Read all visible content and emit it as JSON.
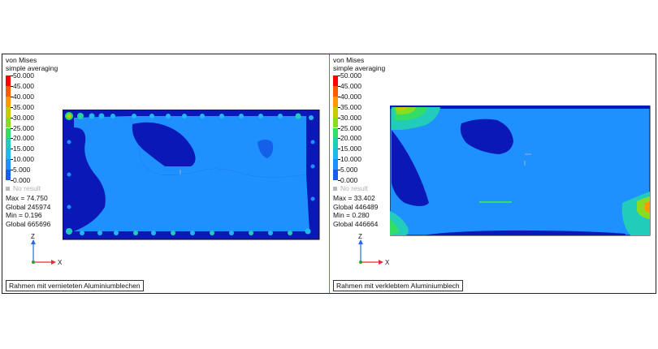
{
  "colors": {
    "legend": [
      "#ff0000",
      "#ff5a00",
      "#ff9900",
      "#c8cc00",
      "#88dd22",
      "#33dd66",
      "#22ccbb",
      "#22b8ee",
      "#1e90ff",
      "#1460e8",
      "#0a18b8"
    ],
    "no_result": "#b8b8b8",
    "panel_divider": "#2a9aa5",
    "axis_x": "#e03030",
    "axis_z": "#2a6adc",
    "axis_y": "#2ea02e"
  },
  "legend_scale": [
    "50.000",
    "45.000",
    "40.000",
    "35.000",
    "30.000",
    "25.000",
    "20.000",
    "15.000",
    "10.000",
    "5.000",
    "0.000"
  ],
  "panels": [
    {
      "result_type": "von Mises",
      "averaging": "simple averaging",
      "no_result": "No result",
      "max": "Max = 74.750",
      "max_global": "Global 245974",
      "min": "Min = 0.196",
      "min_global": "Global 665696",
      "axis_z": "Z",
      "axis_x": "X",
      "caption": "Rahmen mit vernieteten Aluminiumblechen"
    },
    {
      "result_type": "von Mises",
      "averaging": "simple averaging",
      "no_result": "No result",
      "max": "Max = 33.402",
      "max_global": "Global 446489",
      "min": "Min = 0.280",
      "min_global": "Global 446664",
      "axis_z": "Z",
      "axis_x": "X",
      "caption": "Rahmen mit verklebtem Aluminiumblech"
    }
  ]
}
